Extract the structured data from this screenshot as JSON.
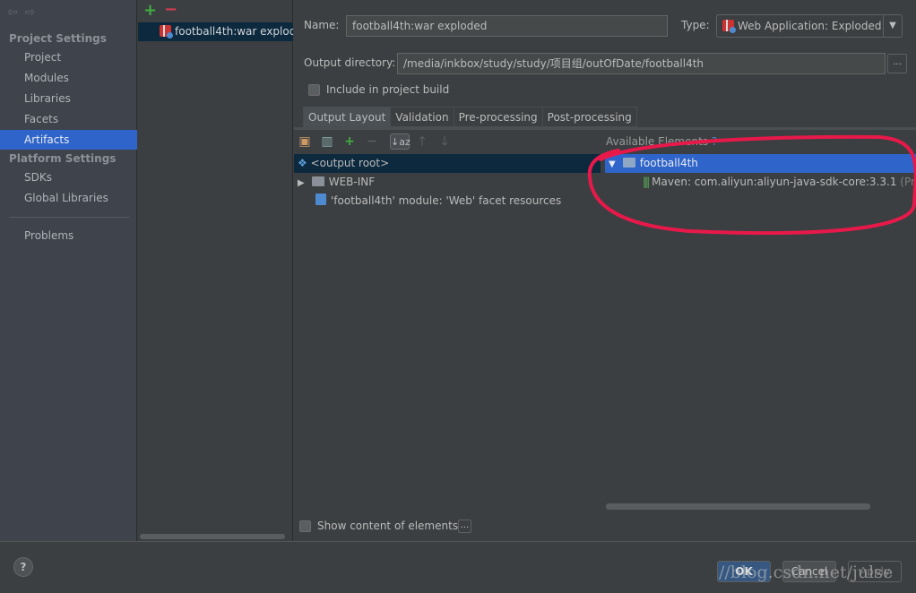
{
  "sidebar": {
    "project_settings": "Project Settings",
    "items": [
      {
        "label": "Project"
      },
      {
        "label": "Modules"
      },
      {
        "label": "Libraries"
      },
      {
        "label": "Facets"
      },
      {
        "label": "Artifacts",
        "selected": true
      }
    ],
    "platform_settings": "Platform Settings",
    "platform_items": [
      {
        "label": "SDKs"
      },
      {
        "label": "Global Libraries"
      }
    ],
    "problems": "Problems"
  },
  "artifacts": {
    "add": "+",
    "remove": "−",
    "list": [
      "football4th:war exploded"
    ]
  },
  "form": {
    "name_label": "Name:",
    "name_value": "football4th:war exploded",
    "type_label": "Type:",
    "type_value": "Web Application: Exploded",
    "output_label": "Output directory:",
    "output_value": "/media/inkbox/study/study/项目组/outOfDate/football4th",
    "browse": "...",
    "include_label": "Include in project build",
    "include_checked": false
  },
  "tabs": [
    {
      "label": "Output Layout",
      "active": true
    },
    {
      "label": "Validation"
    },
    {
      "label": "Pre-processing"
    },
    {
      "label": "Post-processing"
    }
  ],
  "layout_tree": [
    {
      "label": "<output root>",
      "icon": "output-root-icon",
      "selected": true
    },
    {
      "label": "WEB-INF",
      "icon": "folder-icon",
      "expandable": true
    },
    {
      "label": "'football4th' module: 'Web' facet resources",
      "icon": "web-facet-icon"
    }
  ],
  "available": {
    "title": "Available Elements",
    "help": "?",
    "items": [
      {
        "label": "football4th",
        "icon": "module-folder-icon",
        "selected": true
      },
      {
        "label": "Maven: com.aliyun:aliyun-java-sdk-core:3.3.1",
        "suffix": "(Proje",
        "icon": "library-icon"
      }
    ]
  },
  "show_content_label": "Show content of elements",
  "show_content_more": "...",
  "buttons": {
    "help": "?",
    "ok": "OK",
    "cancel": "Cancel",
    "apply": "Apply"
  },
  "watermark": "//blog.csdn.net/julse",
  "colors": {
    "selection": "#2f65ca",
    "tree_selection": "#0d293e",
    "annotation": "#e8194a"
  }
}
